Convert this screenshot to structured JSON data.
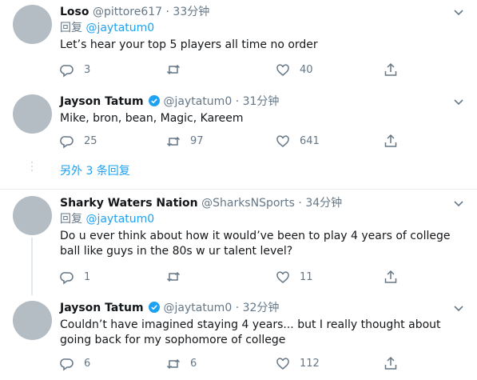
{
  "tweets": [
    {
      "name": "Loso",
      "handle": "@pittore617",
      "sep": "·",
      "time": "33分钟",
      "verified": false,
      "reply_label": "回复",
      "reply_mention": "@jaytatum0",
      "text": "Let’s hear your top 5 players all time no order",
      "reply_count": "3",
      "retweet_count": "",
      "like_count": "40"
    },
    {
      "name": "Jayson Tatum",
      "handle": "@jaytatum0",
      "sep": "·",
      "time": "31分钟",
      "verified": true,
      "text": "Mike, bron, bean, Magic, Kareem",
      "reply_count": "25",
      "retweet_count": "97",
      "like_count": "641"
    },
    {
      "name": "Sharky Waters Nation",
      "handle": "@SharksNSports",
      "sep": "·",
      "time": "34分钟",
      "verified": false,
      "reply_label": "回复",
      "reply_mention": "@jaytatum0",
      "text": "Do u ever think about how it would’ve been to play 4 years of college ball like guys in the 80s w ur talent level?",
      "reply_count": "1",
      "retweet_count": "",
      "like_count": "11"
    },
    {
      "name": "Jayson Tatum",
      "handle": "@jaytatum0",
      "sep": "·",
      "time": "32分钟",
      "verified": true,
      "text": "Couldn’t have imagined staying 4 years... but I really thought about going back for my sophomore  of college",
      "reply_count": "6",
      "retweet_count": "6",
      "like_count": "112"
    }
  ],
  "more_replies": "另外 3 条回复",
  "colors": {
    "accent": "#1da1f2",
    "muted": "#657786",
    "avatar": "#b4bcc4",
    "divider": "#e6ecf0"
  },
  "icons": [
    "reply-icon",
    "retweet-icon",
    "like-icon",
    "share-icon",
    "chevron-down-icon",
    "verified-badge-icon"
  ]
}
